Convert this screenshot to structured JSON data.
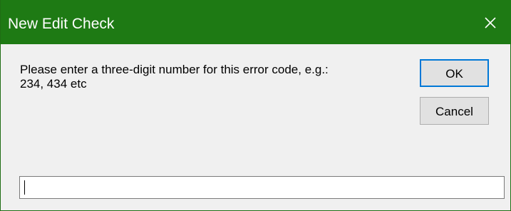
{
  "window": {
    "title": "New Edit Check",
    "accent_color": "#1e7a14"
  },
  "close_icon": "close-icon",
  "message": {
    "line1": "Please enter a three-digit number for this error code, e.g.:",
    "line2": "234, 434 etc"
  },
  "buttons": {
    "ok_label": "OK",
    "cancel_label": "Cancel"
  },
  "input": {
    "value": "",
    "placeholder": ""
  }
}
